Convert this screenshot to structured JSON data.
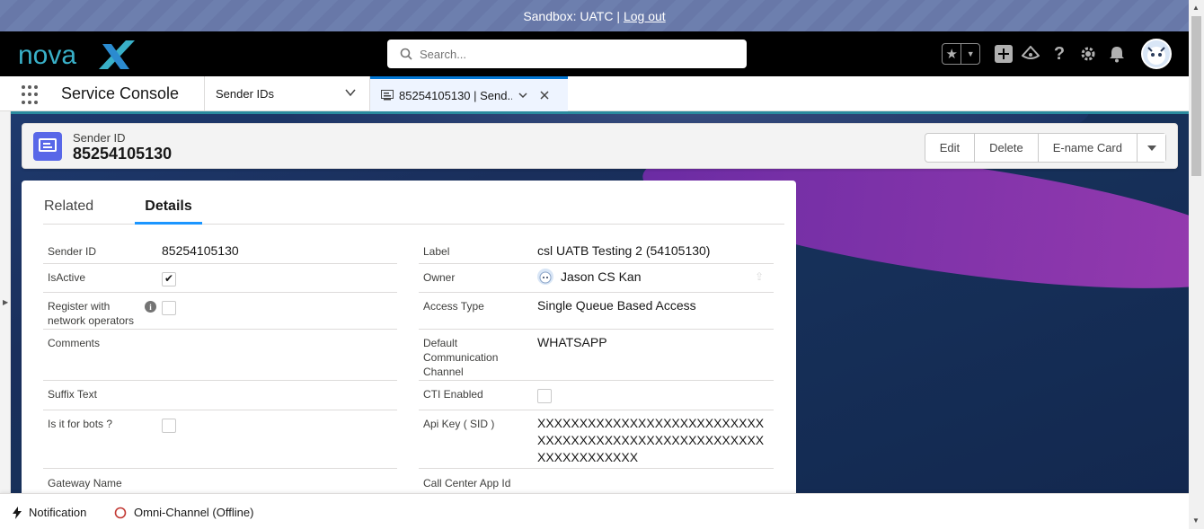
{
  "sandbox": {
    "text": "Sandbox: UATC |",
    "logout": "Log out"
  },
  "header": {
    "logo_text": "novaX",
    "search_placeholder": "Search..."
  },
  "nav": {
    "app_name": "Service Console",
    "object_tab": "Sender IDs",
    "record_tab": "85254105130 | Send..."
  },
  "record": {
    "type_label": "Sender ID",
    "title": "85254105130",
    "buttons": [
      "Edit",
      "Delete",
      "E-name Card"
    ]
  },
  "tabs": {
    "related": "Related",
    "details": "Details"
  },
  "fields_left": [
    {
      "label": "Sender ID",
      "value": "85254105130"
    },
    {
      "label": "IsActive",
      "checked": true
    },
    {
      "label": "Register with network operators",
      "checked": false
    },
    {
      "label": "Comments",
      "value": ""
    },
    {
      "label": "Suffix Text",
      "value": ""
    },
    {
      "label": "Is it for bots ?",
      "checked": false
    },
    {
      "label": "Gateway Name",
      "value": ""
    }
  ],
  "fields_right": [
    {
      "label": "Label",
      "value": "csl UATB Testing 2 (54105130)"
    },
    {
      "label": "Owner",
      "value": "Jason CS Kan"
    },
    {
      "label": "Access Type",
      "value": "Single Queue Based Access"
    },
    {
      "label": "Default Communication Channel",
      "value": "WHATSAPP"
    },
    {
      "label": "CTI Enabled",
      "checked": false
    },
    {
      "label": "Api Key ( SID )",
      "value": "XXXXXXXXXXXXXXXXXXXXXXXXXXXXXXXXXXXXXXXXXXXXXXXXXXXXXXXXXXXXXXXXXX"
    },
    {
      "label": "Call Center App Id",
      "value": ""
    }
  ],
  "utility": {
    "notification": "Notification",
    "omni": "Omni-Channel (Offline)"
  },
  "colors": {
    "brand_blue": "#0176d3",
    "record_icon": "#5867e8",
    "link": "#0b5cab"
  }
}
